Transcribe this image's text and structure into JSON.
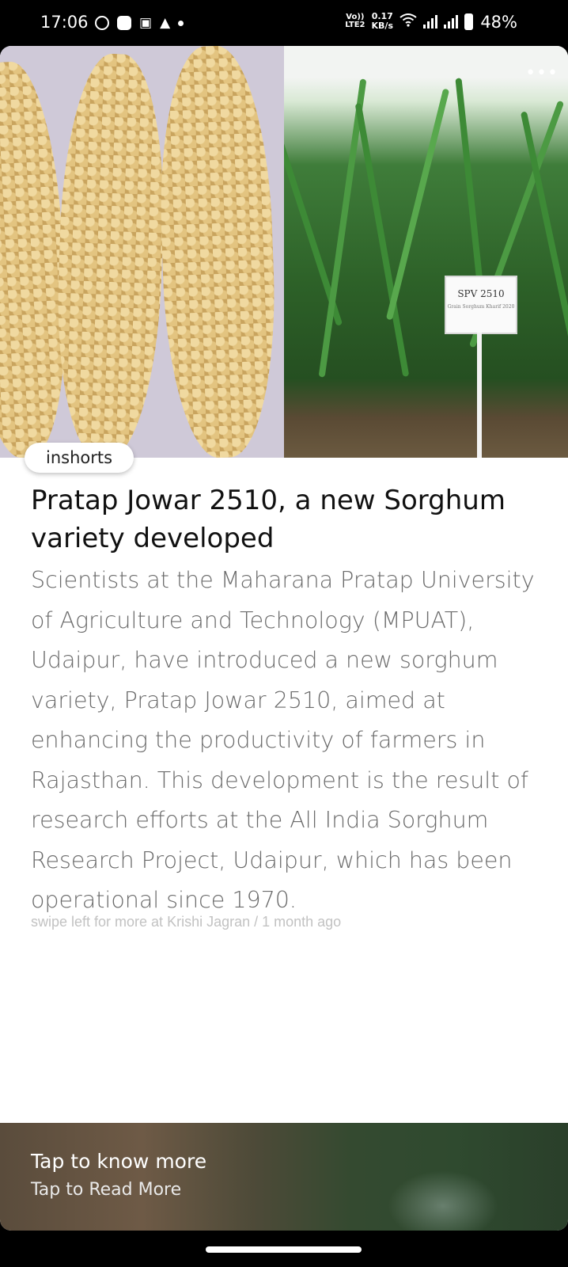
{
  "status_bar": {
    "time": "17:06",
    "left_icons": [
      "whatsapp-icon",
      "bag-icon",
      "notification-icon",
      "navigation-icon",
      "dot-icon"
    ],
    "volte_line1": "Vo))",
    "volte_line2": "LTE2",
    "net_speed_value": "0.17",
    "net_speed_unit": "KB/s",
    "battery_percent": "48%"
  },
  "article": {
    "brand": "inshorts",
    "more_icon": "more-dots-icon",
    "image_sign_code": "SPV 2510",
    "image_sign_caption": "Grain Sorghum Kharif 2020",
    "headline": "Pratap Jowar 2510, a new Sorghum variety developed",
    "body": "Scientists at the Maharana Pratap University of Agriculture and Technology (MPUAT), Udaipur, have introduced a new sorghum variety, Pratap Jowar 2510, aimed at enhancing the productivity of farmers in Rajasthan. This development is the result of research efforts at the All India Sorghum Research Project, Udaipur, which has been operational since 1970.",
    "source_line": "swipe left for more at Krishi Jagran / 1 month ago"
  },
  "footer": {
    "title": "Tap to know more",
    "subtitle": "Tap to Read More"
  }
}
